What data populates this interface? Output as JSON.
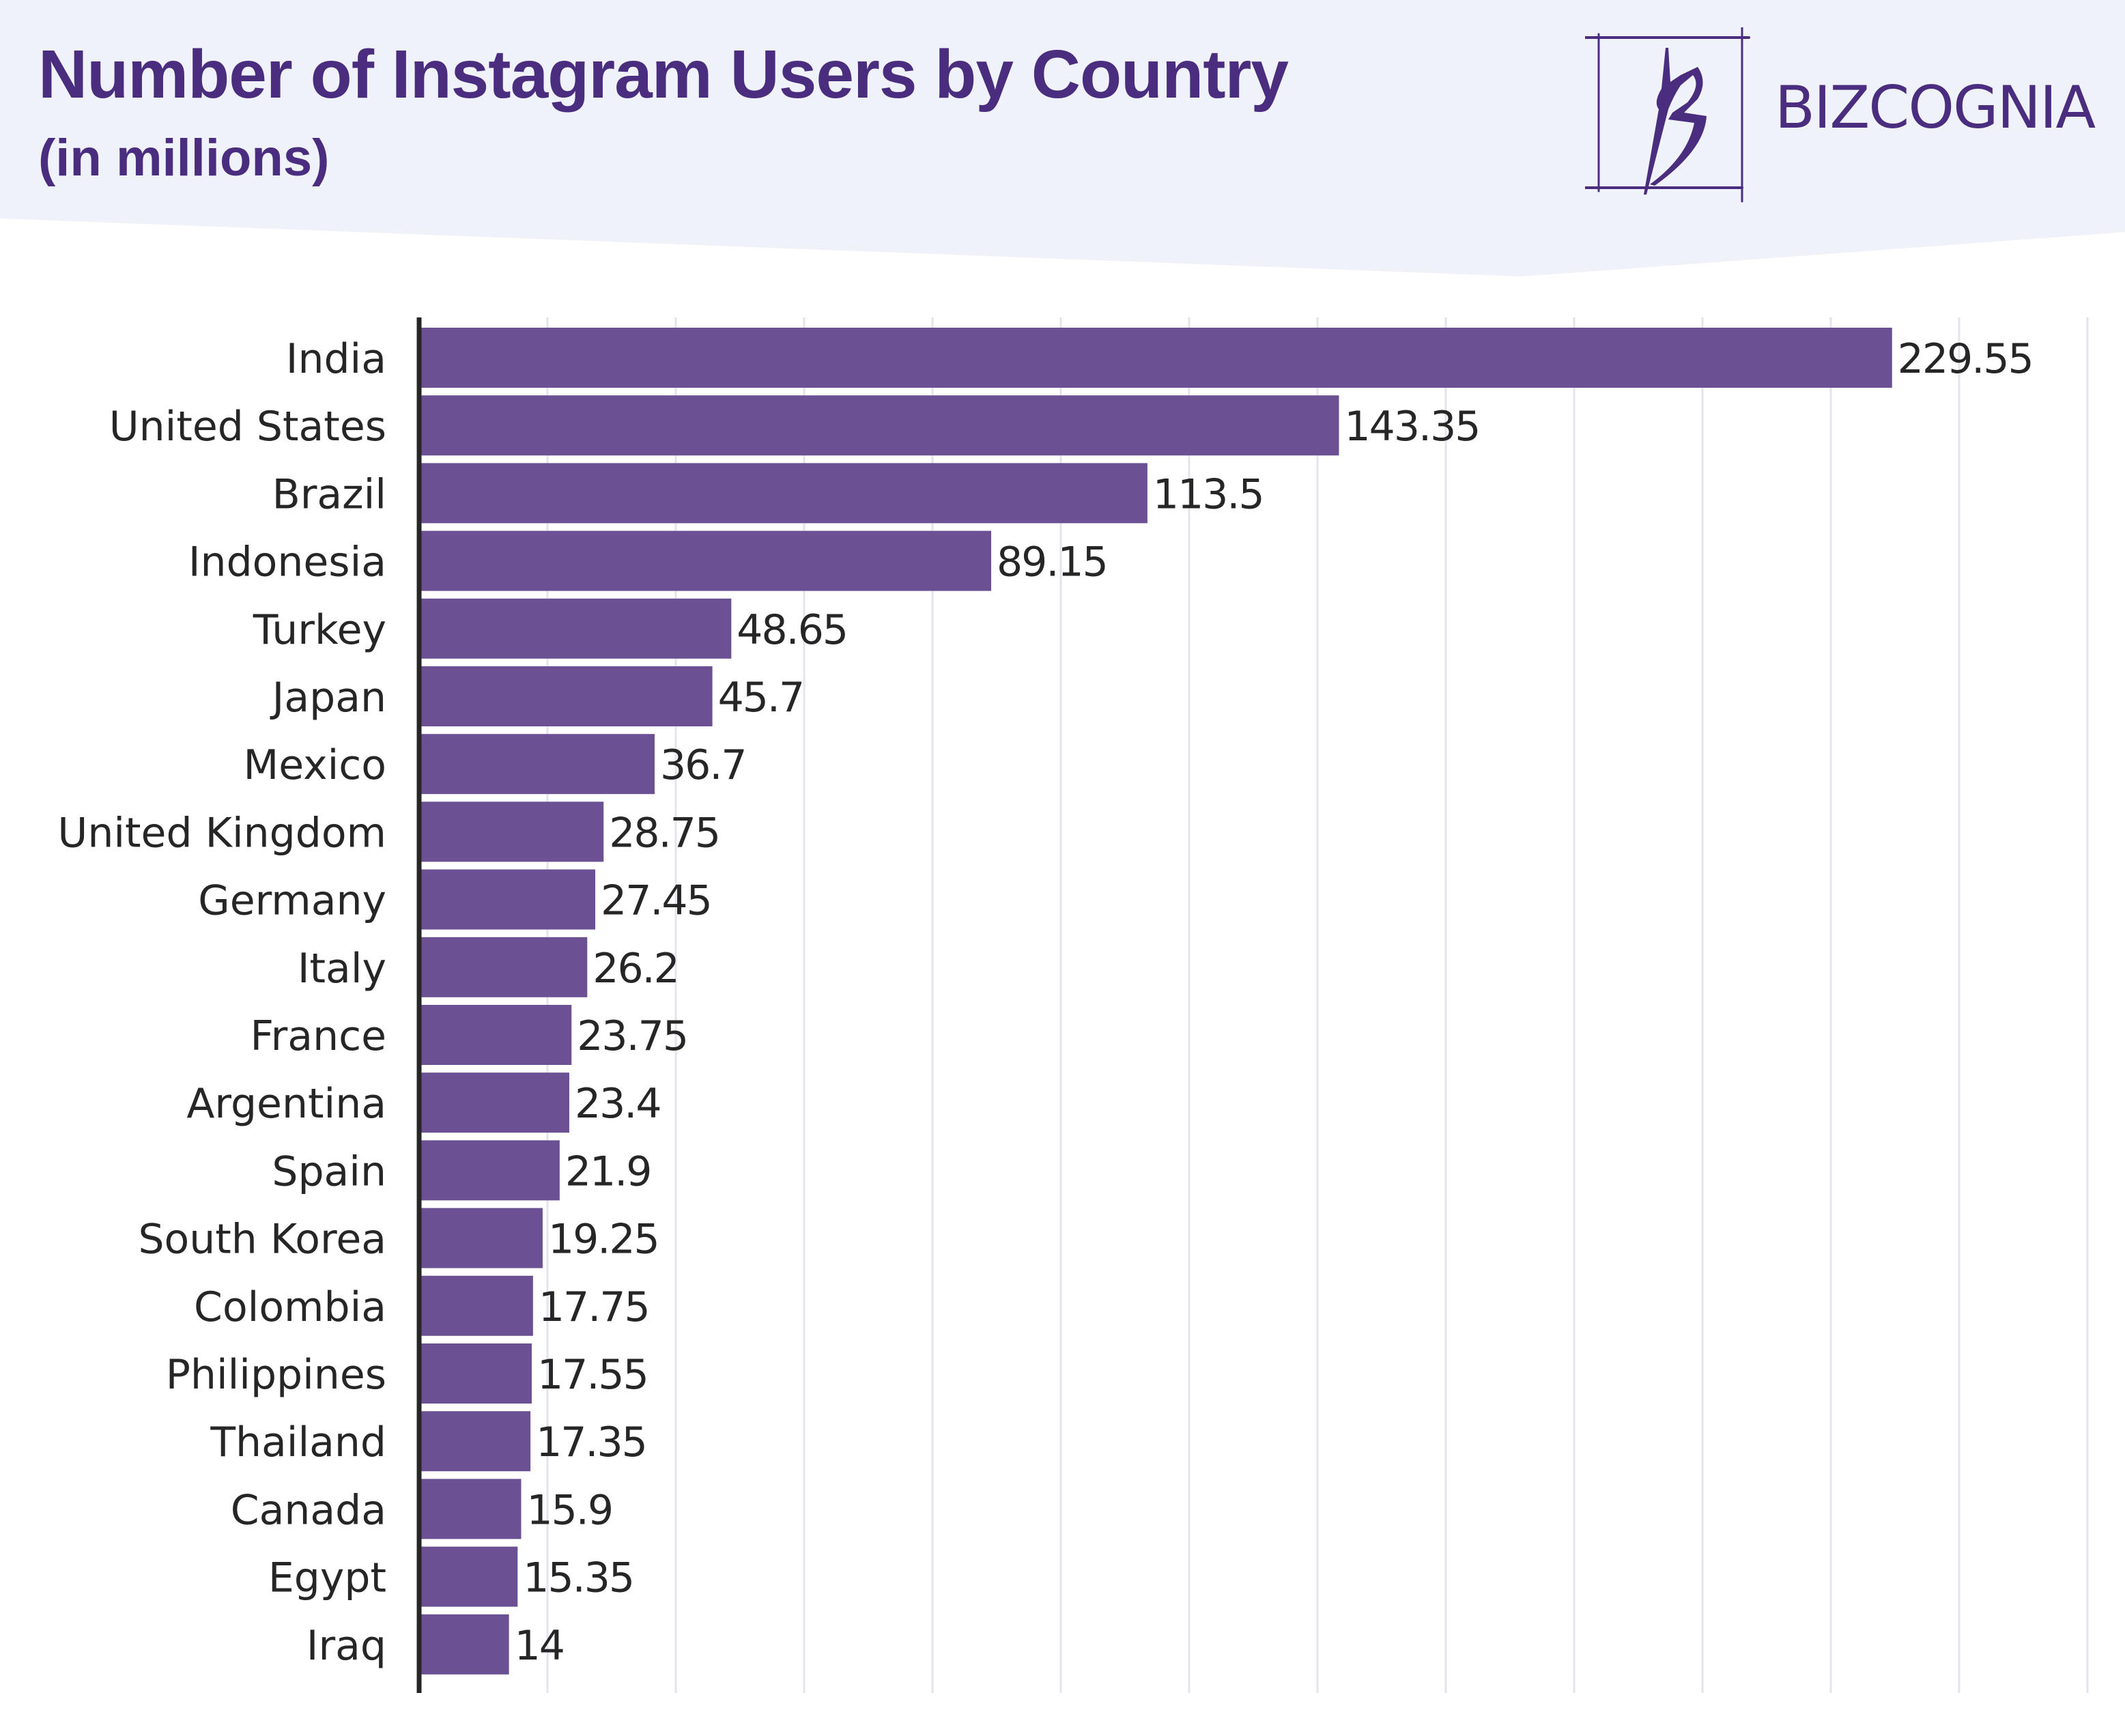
{
  "header": {
    "title": "Number of Instagram Users by Country",
    "subtitle": "(in millions)",
    "brand_name": "BIZCOGNIA",
    "logo_icon": "bizcognia-b-logo-icon"
  },
  "colors": {
    "bar": "#6b5194",
    "title": "#4b2d7f",
    "header_background": "#eff2f9",
    "gridline": "#e4e4ee",
    "axis": "#262626",
    "text": "#262626"
  },
  "chart_data": {
    "type": "bar",
    "orientation": "horizontal",
    "title": "Number of Instagram Users by Country",
    "subtitle": "(in millions)",
    "xlabel": "",
    "ylabel": "",
    "xlim": [
      0,
      260
    ],
    "grid": true,
    "grid_step": 20,
    "tick_labels_shown": false,
    "legend": "none",
    "categories": [
      "India",
      "United States",
      "Brazil",
      "Indonesia",
      "Turkey",
      "Japan",
      "Mexico",
      "United Kingdom",
      "Germany",
      "Italy",
      "France",
      "Argentina",
      "Spain",
      "South Korea",
      "Colombia",
      "Philippines",
      "Thailand",
      "Canada",
      "Egypt",
      "Iraq"
    ],
    "values": [
      229.55,
      143.35,
      113.5,
      89.15,
      48.65,
      45.7,
      36.7,
      28.75,
      27.45,
      26.2,
      23.75,
      23.4,
      21.9,
      19.25,
      17.75,
      17.55,
      17.35,
      15.9,
      15.35,
      14
    ],
    "data_labels": [
      "229.55",
      "143.35",
      "113.5",
      "89.15",
      "48.65",
      "45.7",
      "36.7",
      "28.75",
      "27.45",
      "26.2",
      "23.75",
      "23.4",
      "21.9",
      "19.25",
      "17.75",
      "17.55",
      "17.35",
      "15.9",
      "15.35",
      "14"
    ]
  }
}
